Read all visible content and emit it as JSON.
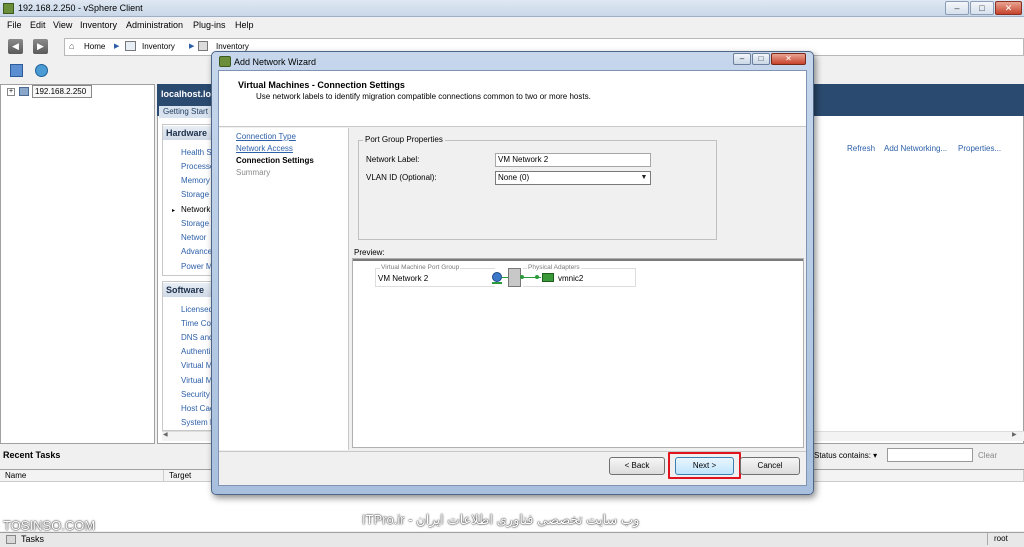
{
  "window": {
    "title": "192.168.2.250 - vSphere Client",
    "buttons": {
      "minimize": "–",
      "maximize": "□",
      "close": "✕"
    }
  },
  "menu": [
    "File",
    "Edit",
    "View",
    "Inventory",
    "Administration",
    "Plug-ins",
    "Help"
  ],
  "breadcrumb": [
    "Home",
    "Inventory",
    "Inventory"
  ],
  "tree": {
    "host": "192.168.2.250",
    "expander": "+"
  },
  "content": {
    "host_title": "localhost.loc",
    "tab": "Getting Start",
    "hardware": {
      "title": "Hardware",
      "items": [
        "Health S",
        "Processo",
        "Memory",
        "Storage",
        "Network",
        "Storage A",
        "Networ",
        "Advance",
        "Power M"
      ]
    },
    "software": {
      "title": "Software",
      "items": [
        "Licensed",
        "Time Con",
        "DNS and",
        "Authenti",
        "Virtual M",
        "Virtual M",
        "Security",
        "Host Cac",
        "System R"
      ]
    },
    "actions": [
      "Refresh",
      "Add Networking...",
      "Properties..."
    ]
  },
  "tasks": {
    "title": "Recent Tasks",
    "filter_label": "Status contains: ▾",
    "clear": "Clear",
    "columns": [
      "Name",
      "Target"
    ]
  },
  "statusbar": {
    "tasks": "Tasks",
    "user": "root"
  },
  "watermark": {
    "left": "TOSINSO.COM",
    "center": "ITPro.ir - وب سایت تخصصی فناوری اطلاعات ایران"
  },
  "wizard": {
    "title": "Add Network Wizard",
    "step_title": "Virtual Machines - Connection Settings",
    "step_desc": "Use network labels to identify migration compatible connections common to two or more hosts.",
    "nav": [
      "Connection Type",
      "Network Access",
      "Connection Settings",
      "Summary"
    ],
    "port_group_legend": "Port Group Properties",
    "network_label_caption": "Network Label:",
    "network_label_value": "VM Network 2",
    "vlan_caption": "VLAN ID (Optional):",
    "vlan_value": "None (0)",
    "preview_label": "Preview:",
    "preview": {
      "pg_caption": "Virtual Machine Port Group",
      "pg_name": "VM Network 2",
      "pa_caption": "Physical Adapters",
      "nic": "vmnic2"
    },
    "buttons": {
      "back": "< Back",
      "next": "Next >",
      "cancel": "Cancel"
    }
  },
  "colors": {
    "highlight": "#e0141e",
    "link": "#2c5fa8",
    "header_bar": "#2b4a6f"
  }
}
